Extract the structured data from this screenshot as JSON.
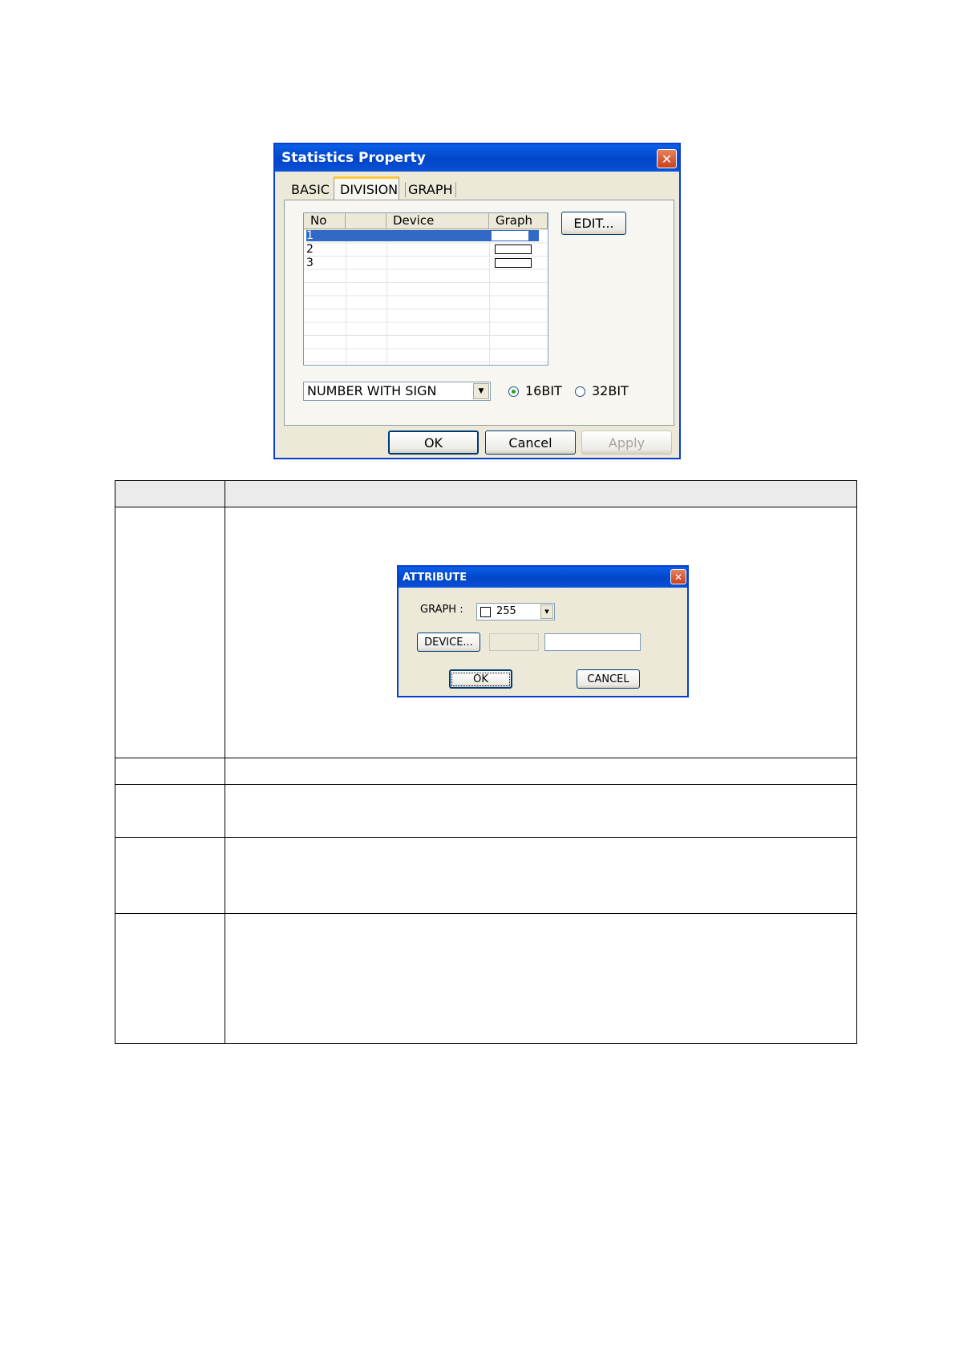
{
  "dialog": {
    "title": "Statistics Property",
    "tabs": [
      "BASIC",
      "DIVISION",
      "GRAPH"
    ],
    "active_tab": "DIVISION",
    "list": {
      "columns": [
        "No",
        "",
        "Device",
        "Graph"
      ],
      "rows": [
        {
          "no": "1",
          "selected": true
        },
        {
          "no": "2",
          "selected": false
        },
        {
          "no": "3",
          "selected": false
        }
      ]
    },
    "edit_button": "EDIT...",
    "format_select": "NUMBER WITH SIGN",
    "radio_16": "16BIT",
    "radio_32": "32BIT",
    "radio_selected": "16BIT",
    "ok": "OK",
    "cancel": "Cancel",
    "apply": "Apply"
  },
  "attribute_dialog": {
    "title": "ATTRIBUTE",
    "graph_label": "GRAPH :",
    "graph_value": "255",
    "device_button": "DEVICE...",
    "ok": "OK",
    "cancel": "CANCEL"
  },
  "colors": {
    "titlebar": "#0A52D8",
    "dialog_bg": "#ECE9D8",
    "selection": "#316AC5",
    "close": "#D8593A"
  }
}
